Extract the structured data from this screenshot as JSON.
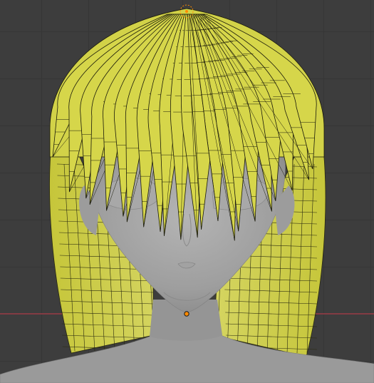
{
  "app": "Blender",
  "view": {
    "kind": "3d-viewport",
    "mode": "edit-mode",
    "background_color": "#3d3d3d",
    "grid_color": "#363636",
    "x_axis_color": "#9b3c46"
  },
  "scene": {
    "objects": [
      {
        "name": "character-head-body",
        "color": "#9a9a9a",
        "shading": "solid"
      },
      {
        "name": "hair-mesh",
        "color": "#d6d64a",
        "wire_color": "#1a1a0a",
        "selected": true
      }
    ],
    "markers": [
      {
        "name": "object-origin",
        "color": "#ff8a00"
      },
      {
        "name": "selected-vertex-cluster",
        "color": "#ff8a00"
      }
    ]
  }
}
